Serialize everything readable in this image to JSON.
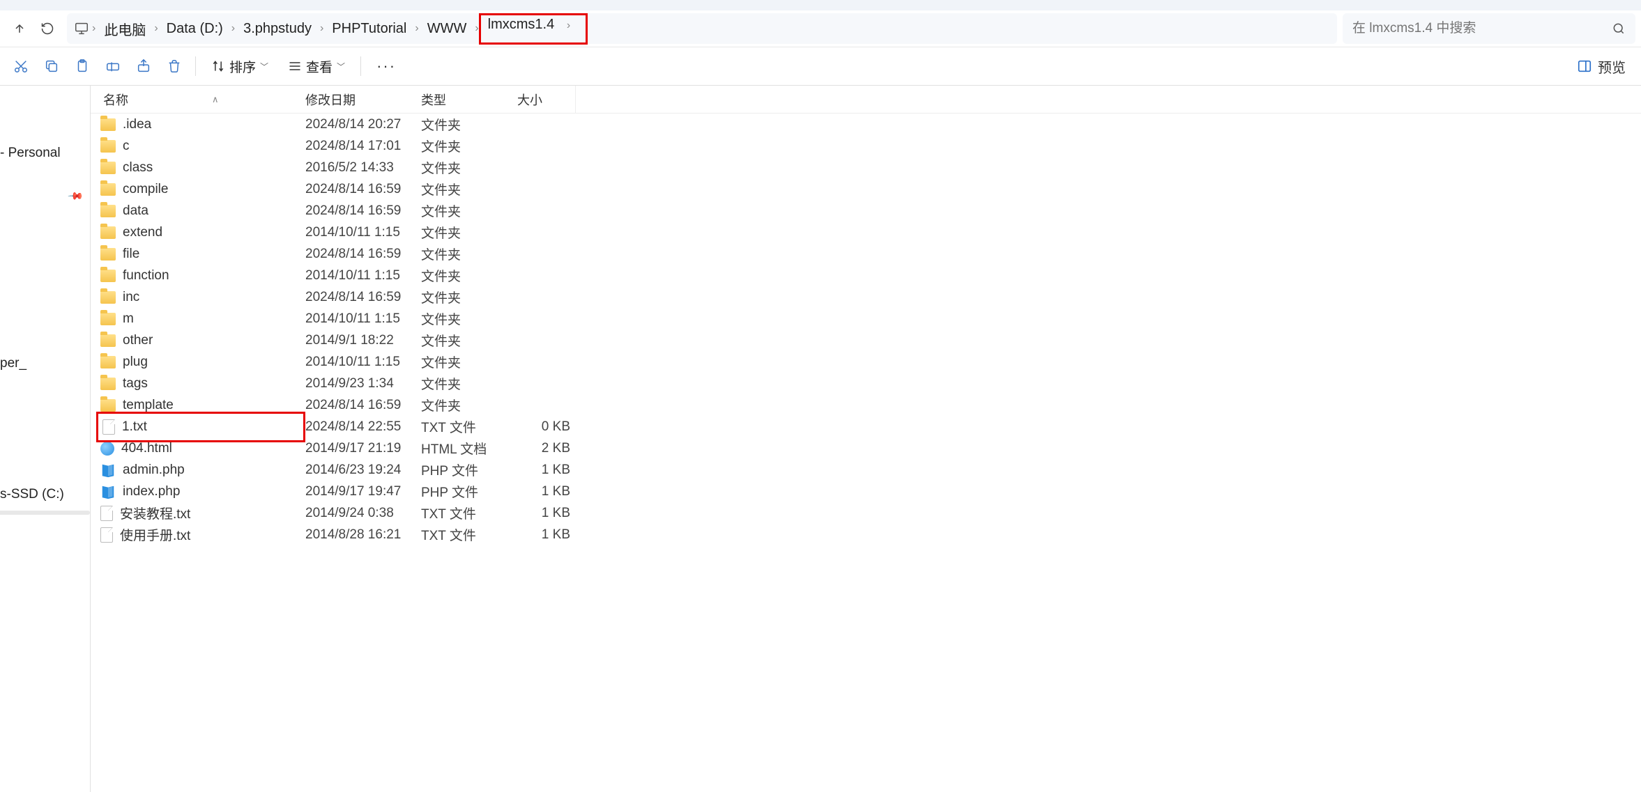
{
  "breadcrumb": [
    {
      "label": "此电脑"
    },
    {
      "label": "Data (D:)"
    },
    {
      "label": "3.phpstudy"
    },
    {
      "label": "PHPTutorial"
    },
    {
      "label": "WWW"
    },
    {
      "label": "lmxcms1.4",
      "highlighted": true
    }
  ],
  "search": {
    "placeholder": "在 lmxcms1.4 中搜索"
  },
  "toolbar": {
    "sort_label": "排序",
    "view_label": "查看",
    "preview_label": "预览"
  },
  "columns": {
    "name": "名称",
    "date": "修改日期",
    "type": "类型",
    "size": "大小"
  },
  "sidebar": {
    "items": [
      {
        "label": "- Personal"
      },
      {
        "label": ""
      },
      {
        "label": ""
      },
      {
        "label": ""
      },
      {
        "label": ""
      },
      {
        "label": ""
      },
      {
        "label": "per_"
      },
      {
        "label": ""
      },
      {
        "label": "s-SSD (C:)"
      }
    ]
  },
  "files": [
    {
      "icon": "folder",
      "name": ".idea",
      "date": "2024/8/14 20:27",
      "type": "文件夹",
      "size": ""
    },
    {
      "icon": "folder",
      "name": "c",
      "date": "2024/8/14 17:01",
      "type": "文件夹",
      "size": ""
    },
    {
      "icon": "folder",
      "name": "class",
      "date": "2016/5/2 14:33",
      "type": "文件夹",
      "size": ""
    },
    {
      "icon": "folder",
      "name": "compile",
      "date": "2024/8/14 16:59",
      "type": "文件夹",
      "size": ""
    },
    {
      "icon": "folder",
      "name": "data",
      "date": "2024/8/14 16:59",
      "type": "文件夹",
      "size": ""
    },
    {
      "icon": "folder",
      "name": "extend",
      "date": "2014/10/11 1:15",
      "type": "文件夹",
      "size": ""
    },
    {
      "icon": "folder",
      "name": "file",
      "date": "2024/8/14 16:59",
      "type": "文件夹",
      "size": ""
    },
    {
      "icon": "folder",
      "name": "function",
      "date": "2014/10/11 1:15",
      "type": "文件夹",
      "size": ""
    },
    {
      "icon": "folder",
      "name": "inc",
      "date": "2024/8/14 16:59",
      "type": "文件夹",
      "size": ""
    },
    {
      "icon": "folder",
      "name": "m",
      "date": "2014/10/11 1:15",
      "type": "文件夹",
      "size": ""
    },
    {
      "icon": "folder",
      "name": "other",
      "date": "2014/9/1 18:22",
      "type": "文件夹",
      "size": ""
    },
    {
      "icon": "folder",
      "name": "plug",
      "date": "2014/10/11 1:15",
      "type": "文件夹",
      "size": ""
    },
    {
      "icon": "folder",
      "name": "tags",
      "date": "2014/9/23 1:34",
      "type": "文件夹",
      "size": ""
    },
    {
      "icon": "folder",
      "name": "template",
      "date": "2024/8/14 16:59",
      "type": "文件夹",
      "size": ""
    },
    {
      "icon": "file",
      "name": "1.txt",
      "date": "2024/8/14 22:55",
      "type": "TXT 文件",
      "size": "0 KB",
      "highlighted": true
    },
    {
      "icon": "html",
      "name": "404.html",
      "date": "2014/9/17 21:19",
      "type": "HTML 文档",
      "size": "2 KB"
    },
    {
      "icon": "php",
      "name": "admin.php",
      "date": "2014/6/23 19:24",
      "type": "PHP 文件",
      "size": "1 KB"
    },
    {
      "icon": "php",
      "name": "index.php",
      "date": "2014/9/17 19:47",
      "type": "PHP 文件",
      "size": "1 KB"
    },
    {
      "icon": "file",
      "name": "安装教程.txt",
      "date": "2014/9/24 0:38",
      "type": "TXT 文件",
      "size": "1 KB"
    },
    {
      "icon": "file",
      "name": "使用手册.txt",
      "date": "2014/8/28 16:21",
      "type": "TXT 文件",
      "size": "1 KB"
    }
  ]
}
